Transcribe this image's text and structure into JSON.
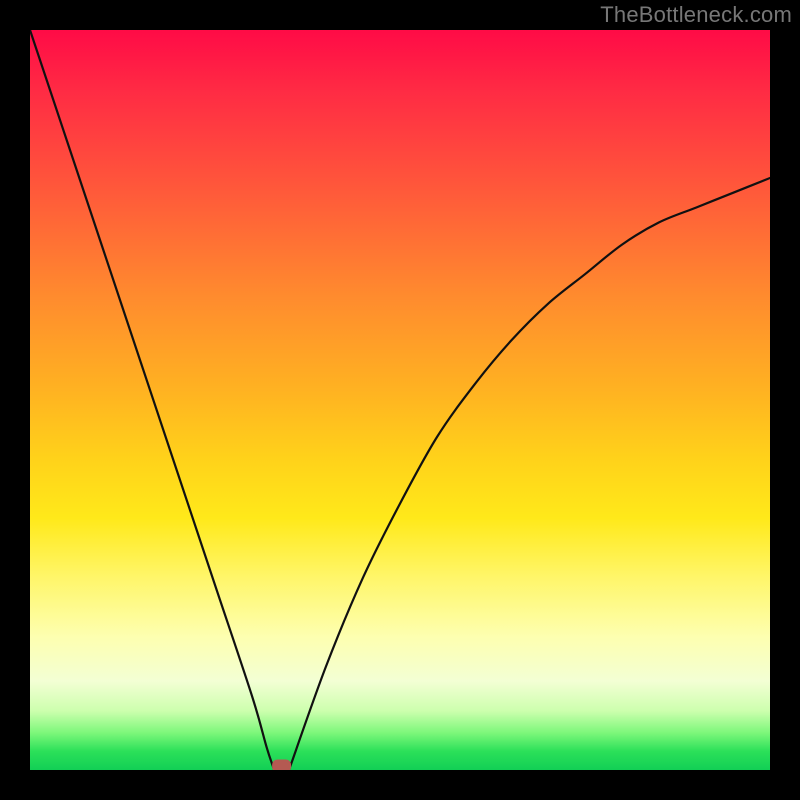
{
  "watermark": "TheBottleneck.com",
  "chart_data": {
    "type": "line",
    "title": "",
    "xlabel": "",
    "ylabel": "",
    "xlim": [
      0,
      100
    ],
    "ylim": [
      0,
      100
    ],
    "grid": false,
    "legend": false,
    "background": "rainbow-gradient",
    "marker": {
      "x": 34,
      "y": 0,
      "shape": "rounded-rect",
      "color": "#b45a52"
    },
    "series": [
      {
        "name": "left-branch",
        "x": [
          0,
          5,
          10,
          15,
          20,
          25,
          30,
          32,
          33
        ],
        "values": [
          100,
          85,
          70,
          55,
          40,
          25,
          10,
          3,
          0
        ]
      },
      {
        "name": "right-branch",
        "x": [
          35,
          40,
          45,
          50,
          55,
          60,
          65,
          70,
          75,
          80,
          85,
          90,
          95,
          100
        ],
        "values": [
          0,
          14,
          26,
          36,
          45,
          52,
          58,
          63,
          67,
          71,
          74,
          76,
          78,
          80
        ]
      }
    ]
  }
}
